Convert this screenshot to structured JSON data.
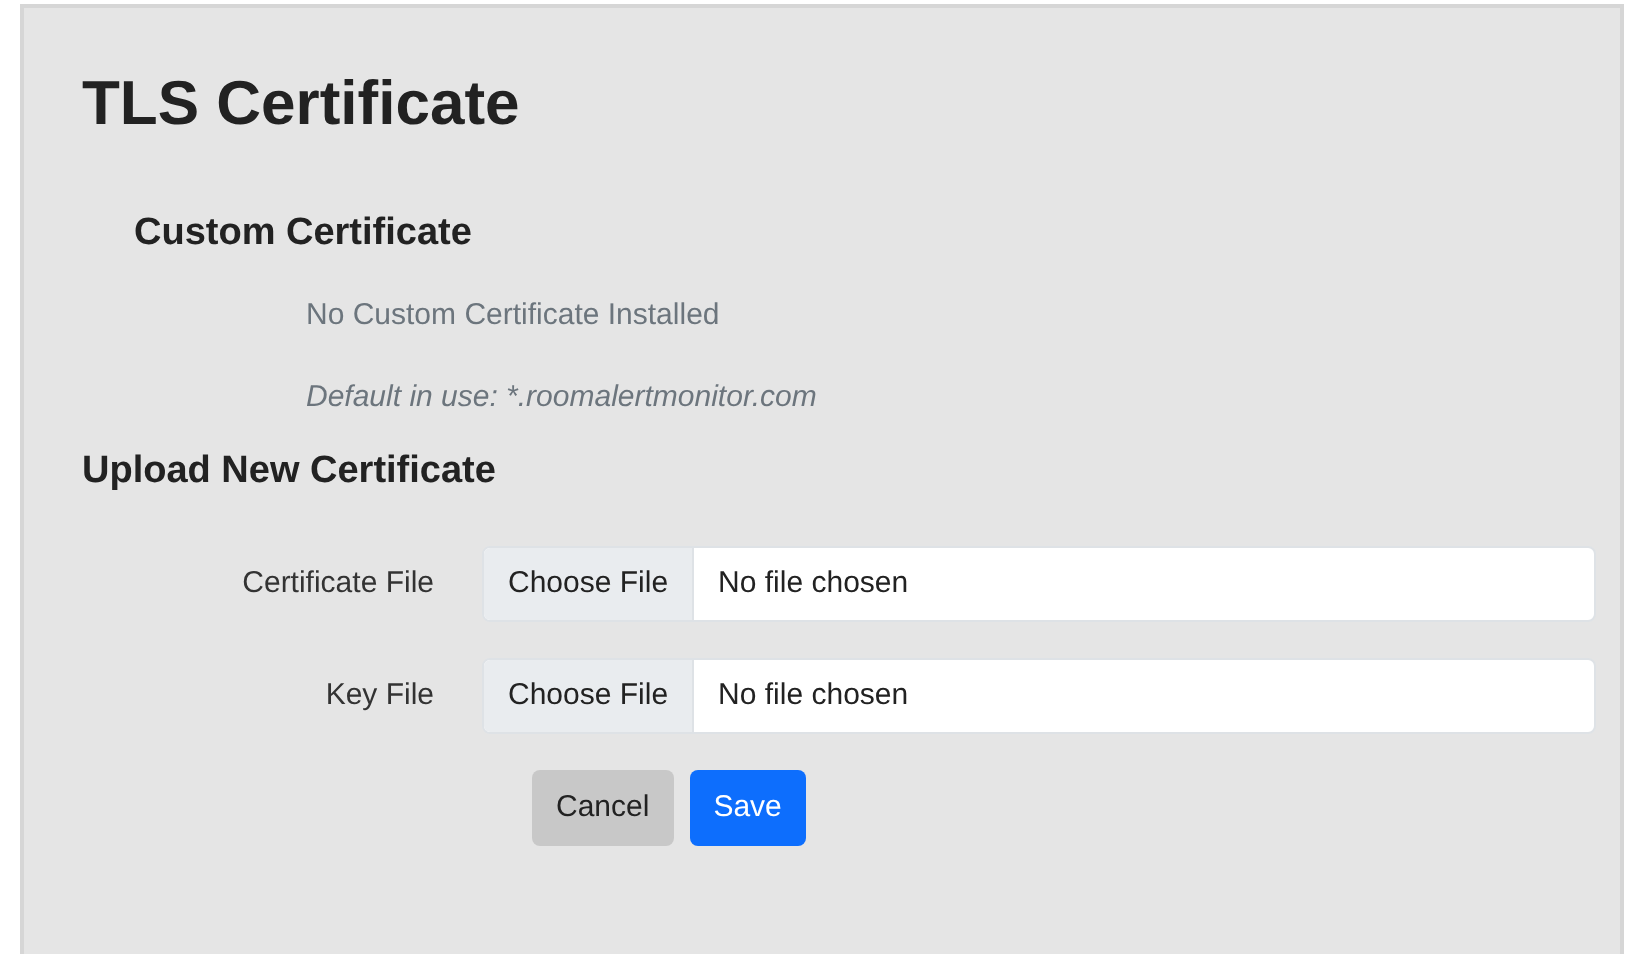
{
  "title": "TLS Certificate",
  "custom": {
    "heading": "Custom Certificate",
    "status": "No Custom Certificate Installed",
    "default_note": "Default in use: *.roomalertmonitor.com"
  },
  "upload": {
    "heading": "Upload New Certificate",
    "fields": [
      {
        "label": "Certificate File",
        "button": "Choose File",
        "value": "No file chosen"
      },
      {
        "label": "Key File",
        "button": "Choose File",
        "value": "No file chosen"
      }
    ]
  },
  "buttons": [
    {
      "label": "Cancel",
      "kind": "secondary"
    },
    {
      "label": "Save",
      "kind": "primary"
    }
  ]
}
